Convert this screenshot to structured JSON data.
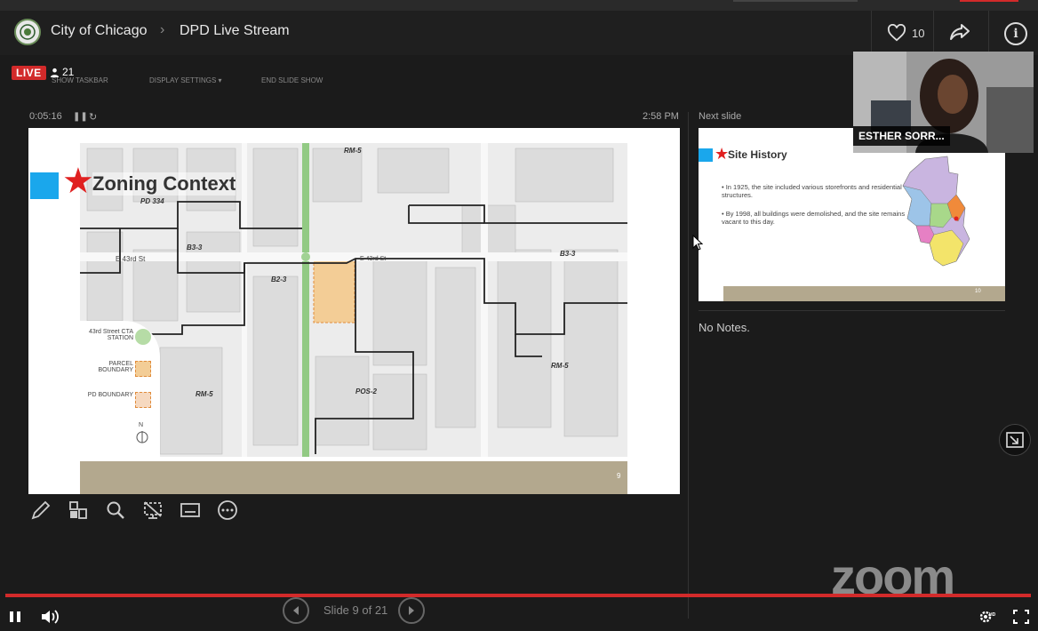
{
  "header": {
    "breadcrumb_1": "City of Chicago",
    "breadcrumb_2": "DPD Live Stream",
    "like_count": "10"
  },
  "stream": {
    "live_label": "LIVE",
    "viewer_count": "21"
  },
  "presenter_toolbar": {
    "taskbar_label": "SHOW TASKBAR",
    "display_settings_label": "DISPLAY SETTINGS ▾",
    "end_show_label": "END SLIDE SHOW"
  },
  "presenter": {
    "elapsed": "0:05:16",
    "clock": "2:58 PM",
    "next_slide_label": "Next slide",
    "notes": "No Notes."
  },
  "current_slide": {
    "title": "Zoning Context",
    "number": "9",
    "legend": {
      "station": "43rd Street CTA STATION",
      "parcel": "PARCEL BOUNDARY",
      "pd": "PD BOUNDARY",
      "north": "N"
    },
    "map_labels": [
      "RM-5",
      "PD 334",
      "B3-3",
      "B2-3",
      "E 43rd St",
      "POS-2",
      "RM-5",
      "RM-5",
      "B3-3"
    ]
  },
  "next_slide": {
    "title": "Site History",
    "bullet_1": "In 1925, the site included various storefronts and residential structures.",
    "bullet_2": "By 1998, all buildings were demolished, and the site remains vacant to this day.",
    "number": "10"
  },
  "webcam": {
    "name": "ESTHER SORR..."
  },
  "controls": {
    "slide_counter": "Slide 9 of 21",
    "progress_fraction": 1.0
  },
  "branding": {
    "zoom_logo": "zoom"
  },
  "colors": {
    "live_red": "#d22a2a",
    "slide_accent_blue": "#1aa7ec",
    "star_red": "#e02020",
    "footer_tan": "#b3a88e"
  }
}
